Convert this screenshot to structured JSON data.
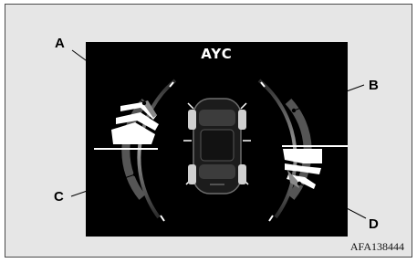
{
  "screen": {
    "title": "AYC"
  },
  "callouts": {
    "a": "A",
    "b": "B",
    "c": "C",
    "d": "D"
  },
  "figure_id": "AFA138444",
  "vehicle_icon": "car-top-view-icon",
  "colors": {
    "screen": "#000000",
    "frame": "#e6e6e6",
    "indicator_lit": "#ffffff",
    "indicator_dim": "#777777"
  }
}
